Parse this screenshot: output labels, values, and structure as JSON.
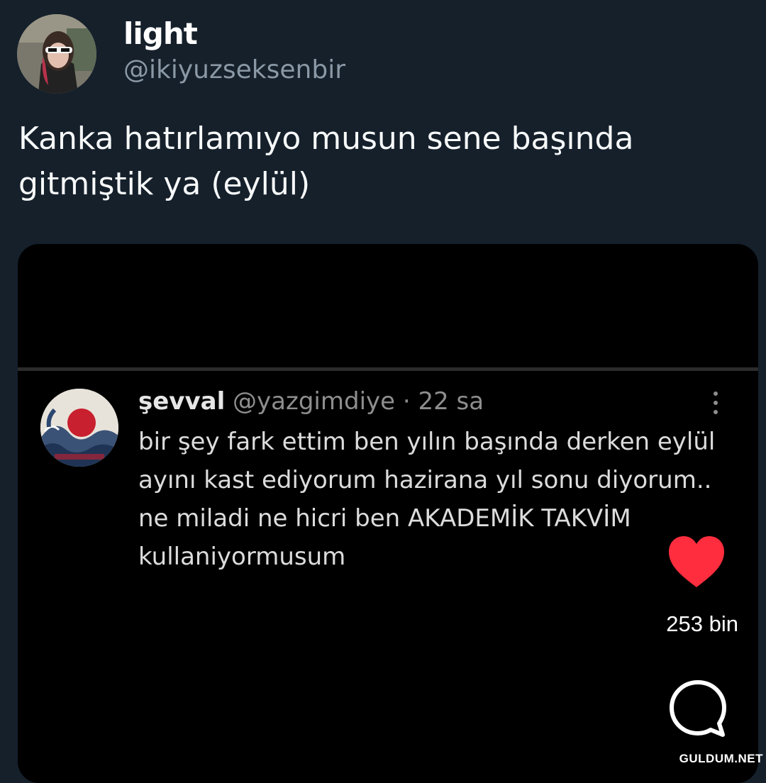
{
  "tweet": {
    "display_name": "light",
    "handle": "@ikiyuzseksenbir",
    "text": "Kanka hatırlamıyo musun sene başında gitmiştik ya (eylül)"
  },
  "media": {
    "post": {
      "name": "şevval",
      "meta": "@yazgimdiye · 22 sa",
      "text": "bir şey fark ettim ben yılın başında derken eylül ayını kast ediyorum hazirana yıl sonu diyorum.. ne miladi ne hicri ben AKADEMİK TAKVİM kullaniyormusum"
    },
    "like_count": "253 bin",
    "heart_color": "#ff2d3d"
  },
  "watermark": "GULDUM.NET"
}
